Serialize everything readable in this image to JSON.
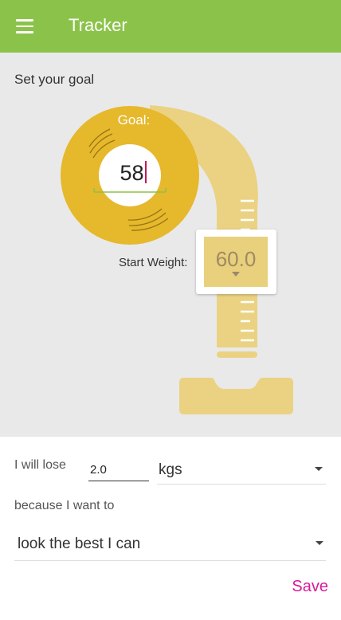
{
  "colors": {
    "appbar": "#8bc34a",
    "accent": "#d81b9a",
    "goal_ring": "#e6b82b",
    "tape": "#ead282"
  },
  "appbar": {
    "title": "Tracker",
    "menu_icon": "hamburger-menu-icon"
  },
  "hero": {
    "section_label": "Set your goal",
    "goal_caption": "Goal:",
    "goal_value": "58",
    "start_weight_label": "Start Weight:",
    "start_weight_value": "60.0"
  },
  "form": {
    "lose_label": "I will lose",
    "lose_amount": "2.0",
    "unit_value": "kgs",
    "because_label": "because I want to",
    "reason_value": "look the best I can",
    "save_label": "Save"
  }
}
